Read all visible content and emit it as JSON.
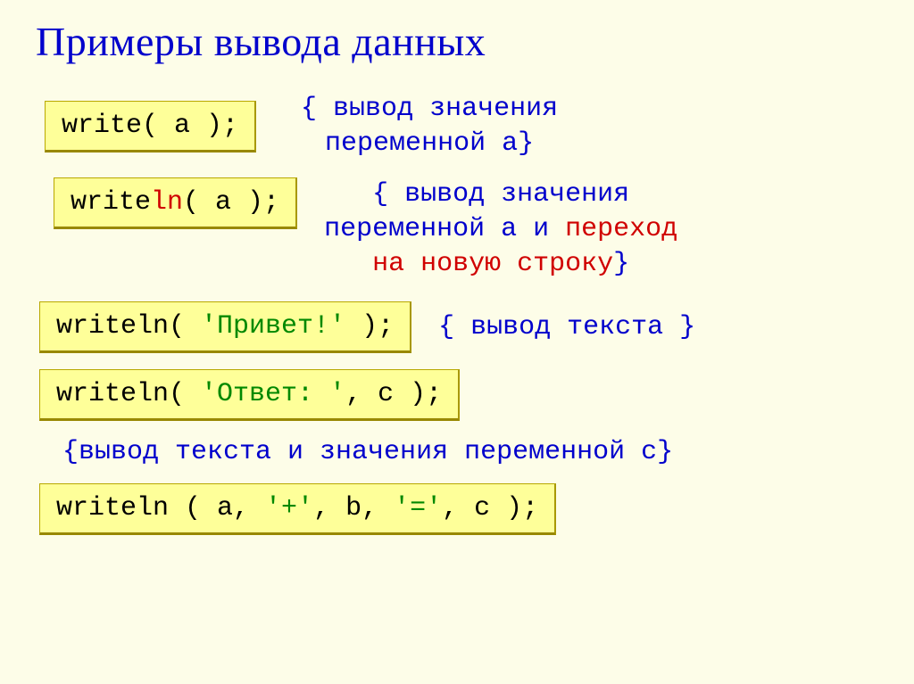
{
  "title": "Примеры вывода данных",
  "rows": {
    "r1": {
      "code_full": "write( a );",
      "comment_line1": "{ вывод значения",
      "comment_line2": "переменной a}"
    },
    "r2": {
      "code_prefix": "write",
      "code_ln": "ln",
      "code_suffix": "( a );",
      "comment_line1": "{ вывод значения",
      "comment_line2": "переменной a и ",
      "comment_red": "переход",
      "comment_line3_red": "на новую строку",
      "comment_line3_end": "}"
    },
    "r3": {
      "code_prefix": "writeln( ",
      "code_str": "'Привет!'",
      "code_suffix": " );",
      "comment": "{ вывод текста }"
    },
    "r4": {
      "code_prefix": "writeln( ",
      "code_str": "'Ответ: '",
      "code_suffix": ", c );"
    },
    "comment4": "{вывод текста и значения переменной c}",
    "r5": {
      "code_p1": "writeln ( a, ",
      "code_s1": "'+'",
      "code_p2": ", b, ",
      "code_s2": "'='",
      "code_p3": ", c );"
    }
  }
}
